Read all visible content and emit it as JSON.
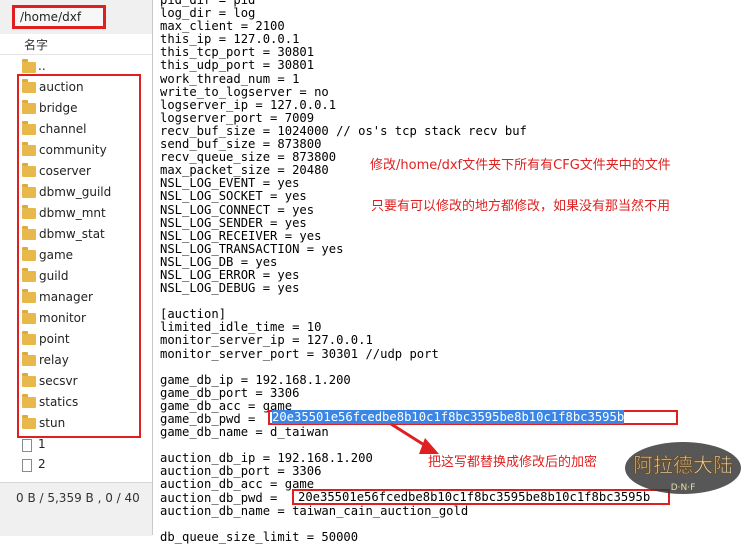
{
  "file_pane": {
    "path": "/home/dxf",
    "column_header": "名字",
    "up_dir": "..",
    "folders": [
      "auction",
      "bridge",
      "channel",
      "community",
      "coserver",
      "dbmw_guild",
      "dbmw_mnt",
      "dbmw_stat",
      "game",
      "guild",
      "manager",
      "monitor",
      "point",
      "relay",
      "secsvr",
      "statics",
      "stun"
    ],
    "files": [
      "1",
      "2"
    ],
    "status": "0 B / 5,359 B , 0 / 40"
  },
  "config_lines": [
    "pid_dir = pid",
    "log_dir = log",
    "max_client = 2100",
    "this_ip = 127.0.0.1",
    "this_tcp_port = 30801",
    "this_udp_port = 30801",
    "work_thread_num = 1",
    "write_to_logserver = no",
    "logserver_ip = 127.0.0.1",
    "logserver_port = 7009",
    "recv_buf_size = 1024000 // os's tcp stack recv buf",
    "send_buf_size = 873800",
    "recv_queue_size = 873800",
    "max_packet_size = 20480",
    "NSL_LOG_EVENT = yes",
    "NSL_LOG_SOCKET = yes",
    "NSL_LOG_CONNECT = yes",
    "NSL_LOG_SENDER = yes",
    "NSL_LOG_RECEIVER = yes",
    "NSL_LOG_TRANSACTION = yes",
    "NSL_LOG_DB = yes",
    "NSL_LOG_ERROR = yes",
    "NSL_LOG_DEBUG = yes",
    "",
    "[auction]",
    "limited_idle_time = 10",
    "monitor_server_ip = 127.0.0.1",
    "monitor_server_port = 30301 //udp port",
    "",
    "game_db_ip = 192.168.1.200",
    "game_db_port = 3306",
    "game_db_acc = game",
    "game_db_pwd = ",
    "game_db_name = d_taiwan",
    "",
    "auction_db_ip = 192.168.1.200",
    "auction_db_port = 3306",
    "auction_db_acc = game",
    "auction_db_pwd = ",
    "auction_db_name = taiwan_cain_auction_gold",
    "",
    "db_queue_size_limit = 50000"
  ],
  "highlight_1": "20e35501e56fcedbe8b10c1f8bc3595be8b10c1f8bc3595b",
  "highlight_2": "20e35501e56fcedbe8b10c1f8bc3595be8b10c1f8bc3595b",
  "annotations": {
    "note1": "修改/home/dxf文件夹下所有有CFG文件夹中的文件",
    "note2": "只要有可以修改的地方都修改，如果没有那当然不用",
    "note3": "把这写都替换成修改后的加密"
  },
  "logo": {
    "text": "阿拉德大陆",
    "sub": "D·N·F"
  },
  "colors": {
    "annotation": "#e02020",
    "selection": "#3a86e6",
    "folder": "#e9b84a"
  }
}
